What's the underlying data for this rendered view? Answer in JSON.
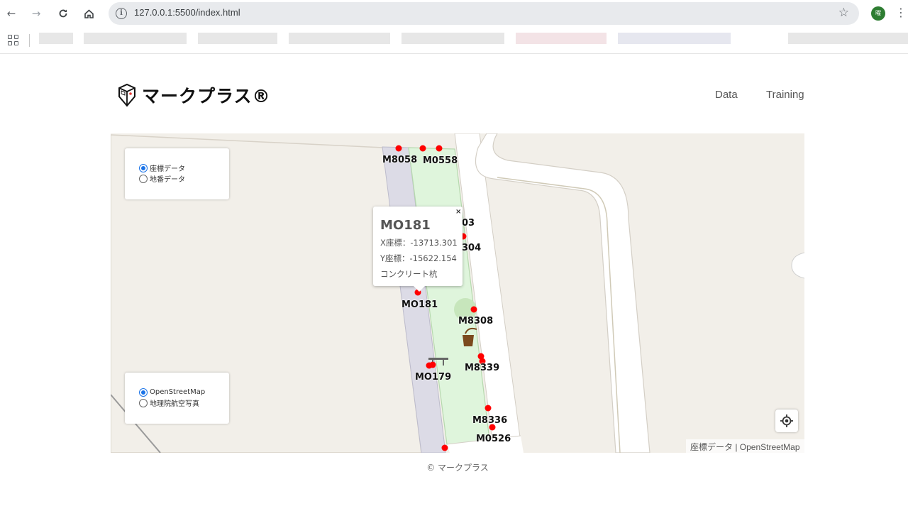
{
  "browser": {
    "url": "127.0.0.1:5500/index.html",
    "profile_initial": "曜",
    "icons": {
      "back": "arrow-left-icon",
      "forward": "arrow-right-icon",
      "reload": "reload-icon",
      "home": "home-icon",
      "info": "info-icon",
      "star": "star-icon",
      "menu": "kebab-menu-icon",
      "apps": "apps-grid-icon"
    }
  },
  "site": {
    "brand": "マークプラス®",
    "nav": [
      {
        "label": "Data"
      },
      {
        "label": "Training"
      }
    ],
    "footer": "© マークプラス"
  },
  "map": {
    "data_layer": {
      "options": [
        {
          "label": "座標データ",
          "selected": true
        },
        {
          "label": "地番データ",
          "selected": false
        }
      ]
    },
    "base_layer": {
      "options": [
        {
          "label": "OpenStreetMap",
          "selected": true
        },
        {
          "label": "地理院航空写真",
          "selected": false
        }
      ]
    },
    "labels": [
      "M8058",
      "M0558",
      "03",
      "304",
      "MO181",
      "M8308",
      "M8339",
      "MO179",
      "M8336",
      "M0526"
    ],
    "popup": {
      "title": "MO181",
      "x_line": "X座標：-13713.301",
      "y_line": "Y座標：-15622.154",
      "type": "コンクリート杭",
      "close": "×"
    },
    "attribution": "座標データ | OpenStreetMap",
    "colors": {
      "marker": "#ff0000",
      "park": "#dff5dc",
      "building": "#dadae6"
    }
  }
}
